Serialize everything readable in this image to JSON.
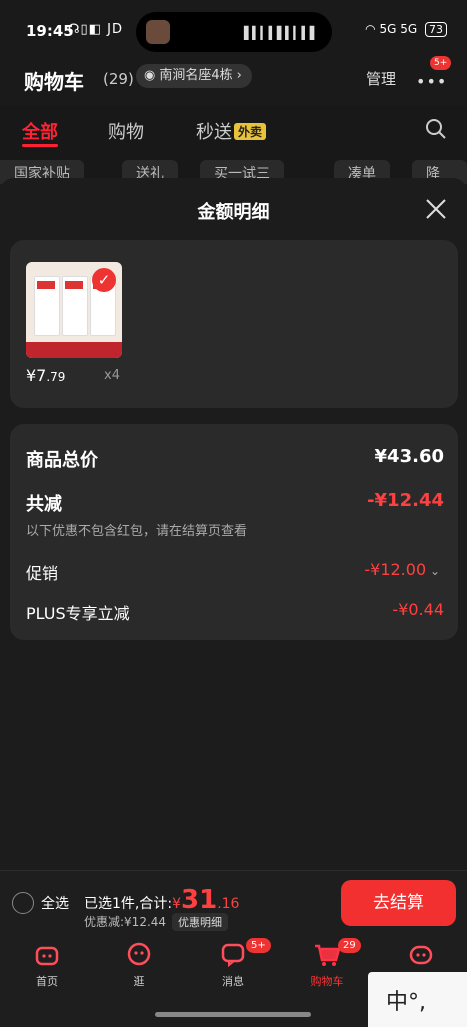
{
  "status": {
    "time": "19:45",
    "left_icons": "☊▯◧ JD",
    "right_icons": "5G 5G",
    "battery": "73"
  },
  "header": {
    "title": "购物车",
    "count": "(29)",
    "address": "南涧名座4栋",
    "manage": "管理",
    "more_badge": "5+"
  },
  "tabs": [
    {
      "label": "全部"
    },
    {
      "label": "购物"
    },
    {
      "label": "秒送",
      "badge": "外卖"
    }
  ],
  "chips": [
    "国家补贴",
    "送礼",
    "买一试三",
    "凑单",
    "降价"
  ],
  "sheet": {
    "title": "金额明细",
    "product": {
      "price_int": "¥7",
      "price_dec": ".79",
      "qty": "x4"
    },
    "rows": {
      "total_label": "商品总价",
      "total_value": "¥43.60",
      "reduce_label": "共减",
      "reduce_value": "-¥12.44",
      "reduce_note": "以下优惠不包含红包，请在结算页查看",
      "promo_label": "促销",
      "promo_value": "-¥12.00",
      "plus_label": "PLUS专享立减",
      "plus_value": "-¥0.44"
    }
  },
  "bottom": {
    "select_all": "全选",
    "selected_text": "已选1件,合计:",
    "currency": "¥",
    "total_int": "31",
    "total_dec": ".16",
    "discount_text": "优惠减:¥12.44",
    "detail_button": "优惠明细",
    "checkout": "去结算"
  },
  "nav": [
    {
      "label": "首页"
    },
    {
      "label": "逛"
    },
    {
      "label": "消息",
      "badge": "5+"
    },
    {
      "label": "购物车",
      "badge": "29"
    },
    {
      "label": ""
    }
  ],
  "ime": {
    "text": "中°,"
  },
  "colors": {
    "accent": "#f23030",
    "background": "#1b1b1b",
    "card": "#2a2a2a"
  }
}
